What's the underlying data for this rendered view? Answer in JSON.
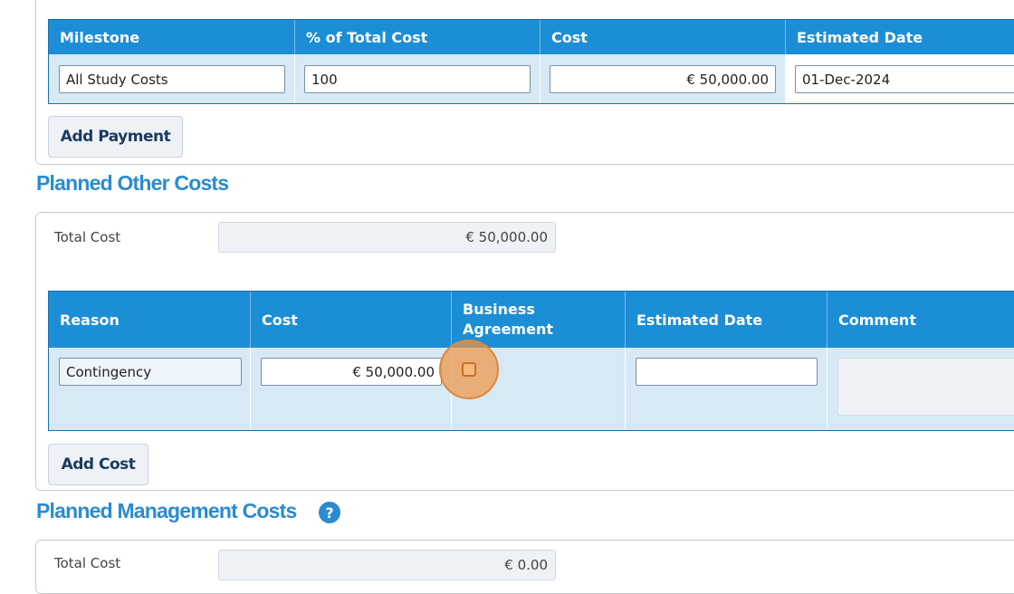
{
  "payments": {
    "columns": [
      "Milestone",
      "% of Total Cost",
      "Cost",
      "Estimated Date"
    ],
    "row": {
      "milestone": "All Study Costs",
      "percent": "100",
      "cost": "€ 50,000.00",
      "estimated_date": "01-Dec-2024"
    },
    "add_button": "Add Payment"
  },
  "other_costs": {
    "title": "Planned Other Costs",
    "total_label": "Total Cost",
    "total_value": "€ 50,000.00",
    "columns": [
      "Reason",
      "Cost",
      "Business Agreement",
      "Estimated Date",
      "Comment"
    ],
    "row": {
      "reason": "Contingency",
      "cost": "€ 50,000.00",
      "business_agreement_checked": false,
      "estimated_date": "",
      "comment": ""
    },
    "add_button": "Add Cost"
  },
  "management_costs": {
    "title": "Planned Management Costs",
    "help_icon": "question-circle-icon",
    "total_label": "Total Cost",
    "total_value": "€ 0.00"
  },
  "colors": {
    "header_blue": "#1c8ed6",
    "row_bg": "#d6e9f5",
    "title_blue": "#2a8bd0",
    "highlight_orange": "#f0a050"
  }
}
